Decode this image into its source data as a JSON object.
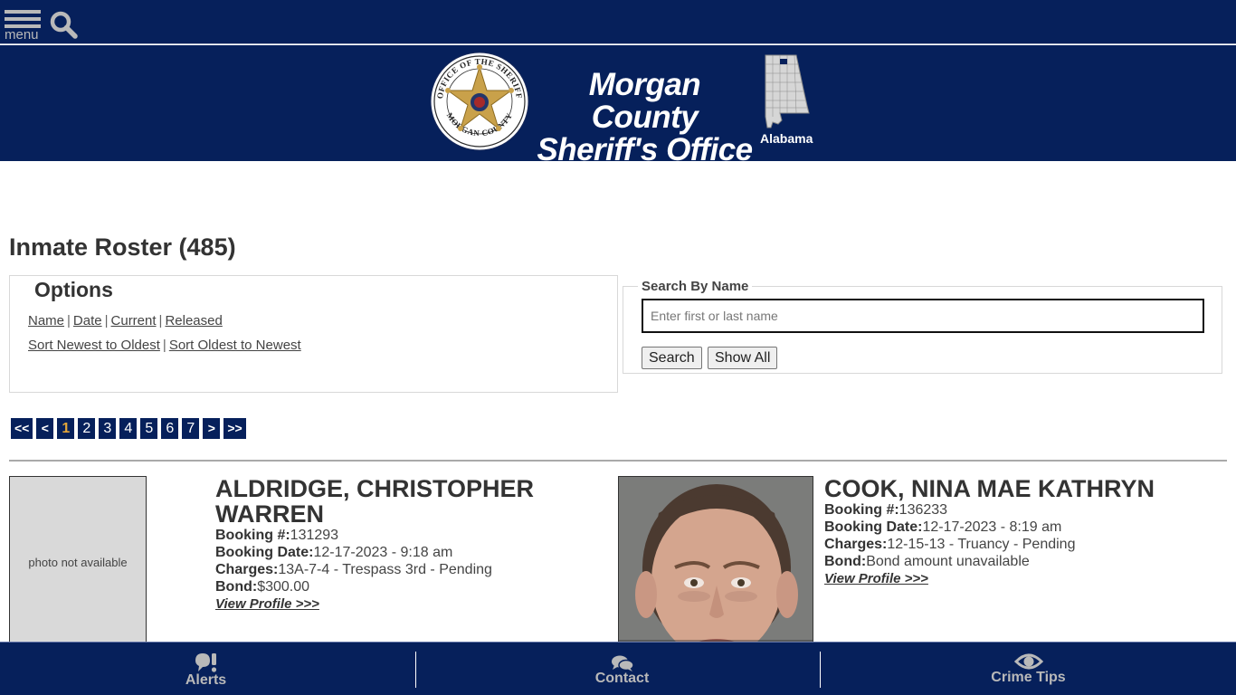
{
  "topbar": {
    "menu_label": "menu",
    "menu_icon": "hamburger-icon",
    "search_icon": "search-icon"
  },
  "header": {
    "title_line1": "Morgan County",
    "title_line2": "Sheriff's Office",
    "state_label": "Alabama",
    "seal_text_top": "OFFICE OF THE SHERIFF",
    "seal_text_bottom": "MORGAN COUNTY",
    "badge_text": "SHERIFF",
    "brand_color": "#06205b"
  },
  "page": {
    "title": "Inmate Roster (485)"
  },
  "options": {
    "legend": "Options",
    "filters": [
      "Name",
      "Date",
      "Current",
      "Released"
    ],
    "sorts": [
      "Sort Newest to Oldest",
      "Sort Oldest to Newest"
    ],
    "separator": "|"
  },
  "search": {
    "legend": "Search By Name",
    "placeholder": "Enter first or last name",
    "value": "",
    "search_button": "Search",
    "show_all_button": "Show All"
  },
  "pagination": {
    "first": "<<",
    "prev": "<",
    "pages": [
      "1",
      "2",
      "3",
      "4",
      "5",
      "6",
      "7"
    ],
    "current": "1",
    "next": ">",
    "last": ">>",
    "current_color": "#e3a63a"
  },
  "inmates": [
    {
      "name": "ALDRIDGE, CHRISTOPHER WARREN",
      "photo_text": "photo not available",
      "booking_label": "Booking #:",
      "booking_number": "131293",
      "booking_date_label": "Booking Date:",
      "booking_date": "12-17-2023 - 9:18 am",
      "charges_label": "Charges:",
      "charges": "13A-7-4 - Trespass 3rd - Pending",
      "bond_label": "Bond:",
      "bond": "$300.00",
      "view_link": "View Profile >>>"
    },
    {
      "name": "COOK, NINA MAE KATHRYN",
      "photo_text": "",
      "booking_label": "Booking #:",
      "booking_number": "136233",
      "booking_date_label": "Booking Date:",
      "booking_date": "12-17-2023 - 8:19 am",
      "charges_label": "Charges:",
      "charges": "12-15-13 - Truancy - Pending",
      "bond_label": "Bond:",
      "bond": "Bond amount unavailable",
      "view_link": "View Profile >>>"
    }
  ],
  "bottom_nav": [
    {
      "label": "Alerts",
      "icon": "alert-bubble-icon"
    },
    {
      "label": "Contact",
      "icon": "chat-bubbles-icon"
    },
    {
      "label": "Crime Tips",
      "icon": "eye-icon"
    }
  ]
}
